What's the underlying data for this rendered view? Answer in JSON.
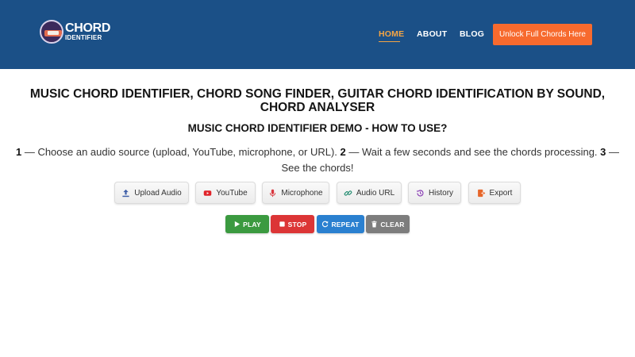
{
  "header": {
    "logo": {
      "line1": "CHORD",
      "line2": "IDENTIFIER"
    },
    "nav": [
      {
        "label": "HOME",
        "active": true
      },
      {
        "label": "ABOUT",
        "active": false
      },
      {
        "label": "BLOG",
        "active": false
      }
    ],
    "cta_label": "Unlock Full Chords Here",
    "colors": {
      "background": "#1b5087",
      "active_nav": "#f3a545",
      "cta": "#f76a2e"
    }
  },
  "main": {
    "title": "MUSIC CHORD IDENTIFIER, CHORD SONG FINDER, GUITAR CHORD IDENTIFICATION BY SOUND, CHORD ANALYSER",
    "subtitle": "MUSIC CHORD IDENTIFIER DEMO - HOW TO USE?",
    "steps": [
      {
        "num": "1",
        "text": "— Choose an audio source (upload, YouTube, microphone, or URL)."
      },
      {
        "num": "2",
        "text": "— Wait a few seconds and see the chords processing."
      },
      {
        "num": "3",
        "text": "— See the chords!"
      }
    ]
  },
  "sources": [
    {
      "label": "Upload Audio",
      "icon": "upload-icon",
      "color": "#3f5fa8"
    },
    {
      "label": "YouTube",
      "icon": "youtube-icon",
      "color": "#e0242a"
    },
    {
      "label": "Microphone",
      "icon": "microphone-icon",
      "color": "#d9363e"
    },
    {
      "label": "Audio URL",
      "icon": "link-icon",
      "color": "#1f8a6e"
    },
    {
      "label": "History",
      "icon": "history-icon",
      "color": "#8a3fb5"
    },
    {
      "label": "Export",
      "icon": "export-icon",
      "color": "#e6662a"
    }
  ],
  "controls": [
    {
      "label": "PLAY",
      "icon": "play-icon",
      "color": "#3b9a40"
    },
    {
      "label": "STOP",
      "icon": "stop-icon",
      "color": "#dc3536"
    },
    {
      "label": "REPEAT",
      "icon": "repeat-icon",
      "color": "#2a80d0"
    },
    {
      "label": "CLEAR",
      "icon": "trash-icon",
      "color": "#7d7d7d"
    }
  ]
}
